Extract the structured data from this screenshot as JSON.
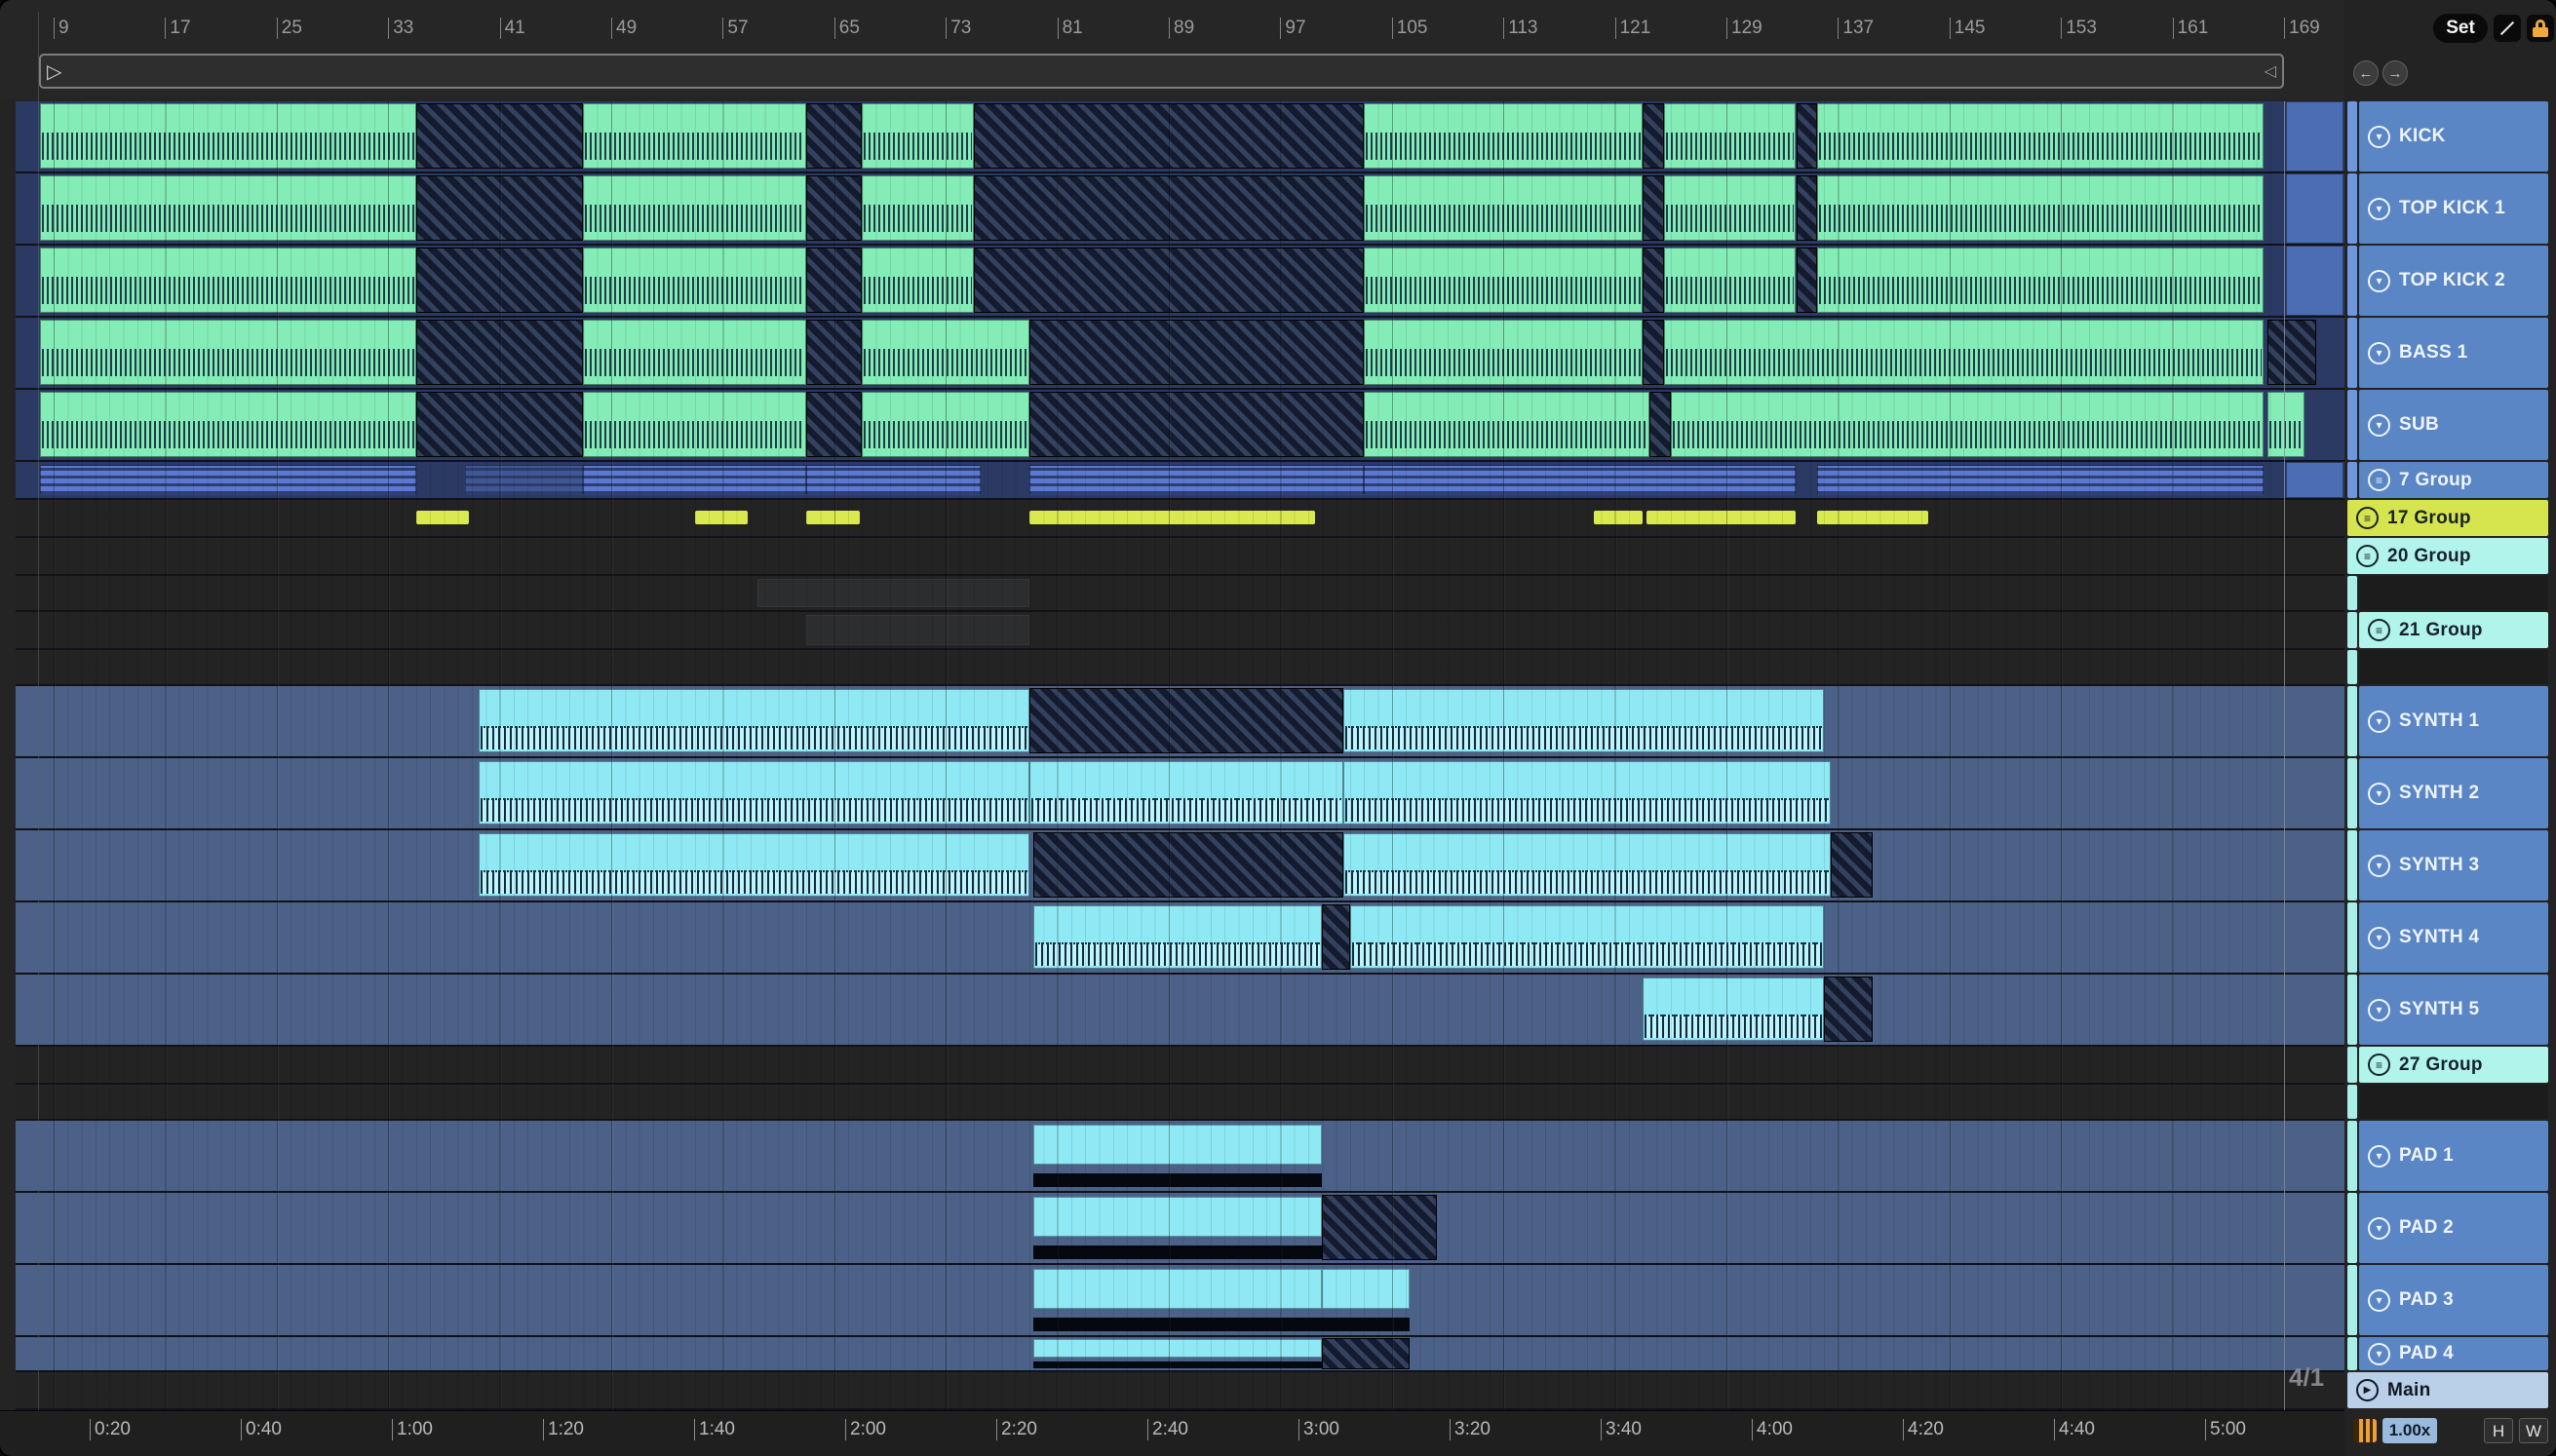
{
  "controls": {
    "set_label": "Set",
    "speed": "1.00x",
    "h_label": "H",
    "w_label": "W",
    "back_arrow": "←",
    "forward_arrow": "→",
    "icons": [
      "draw-mode-icon",
      "lock-icon",
      "audio-engine-icon"
    ]
  },
  "markers": {
    "time_signature": "4/1",
    "scroll_play_glyph": "▷",
    "scroll_end_glyph": "◁"
  },
  "ruler_top": {
    "bar_numbers": [
      9,
      17,
      25,
      33,
      41,
      49,
      57,
      65,
      73,
      81,
      89,
      97,
      105,
      113,
      121,
      129,
      137,
      145,
      153,
      161,
      169
    ]
  },
  "ruler_bottom": {
    "time_labels": [
      "0:20",
      "0:40",
      "1:00",
      "1:20",
      "1:40",
      "2:00",
      "2:20",
      "2:40",
      "3:00",
      "3:20",
      "3:40",
      "4:00",
      "4:20",
      "4:40",
      "5:00"
    ]
  },
  "colors": {
    "clip_green": "#84ecb6",
    "clip_cyan": "#8fe9f5",
    "clip_yellow": "#d9e94f",
    "clip_blue": "#5b79d2",
    "header_blue": "#5b86c5",
    "header_yellow": "#d6e54d",
    "header_cyan": "#b0f4ec",
    "header_main": "#bacfe8",
    "lock_orange": "#eda83f"
  },
  "tracks": [
    {
      "name": "KICK",
      "icon": "collapse",
      "header": "blue",
      "strip": "blue",
      "size": "tall",
      "zone": "navy",
      "clips": [
        {
          "s": 8,
          "e": 35,
          "k": "green"
        },
        {
          "s": 35,
          "e": 47,
          "k": "hatch"
        },
        {
          "s": 47,
          "e": 63,
          "k": "green"
        },
        {
          "s": 63,
          "e": 67,
          "k": "hatch"
        },
        {
          "s": 67,
          "e": 75,
          "k": "green"
        },
        {
          "s": 75,
          "e": 103,
          "k": "hatch"
        },
        {
          "s": 103,
          "e": 123,
          "k": "green"
        },
        {
          "s": 123,
          "e": 124.5,
          "k": "hatch"
        },
        {
          "s": 124.5,
          "e": 134,
          "k": "green"
        },
        {
          "s": 134,
          "e": 135.5,
          "k": "hatch"
        },
        {
          "s": 135.5,
          "e": 167.5,
          "k": "green"
        },
        {
          "s": 169.2,
          "e": 173.2,
          "k": "endblue"
        }
      ]
    },
    {
      "name": "TOP KICK 1",
      "icon": "collapse",
      "header": "blue",
      "strip": "blue",
      "size": "tall",
      "zone": "navy",
      "clips": [
        {
          "s": 8,
          "e": 35,
          "k": "green"
        },
        {
          "s": 35,
          "e": 47,
          "k": "hatch"
        },
        {
          "s": 47,
          "e": 63,
          "k": "green"
        },
        {
          "s": 63,
          "e": 67,
          "k": "hatch"
        },
        {
          "s": 67,
          "e": 75,
          "k": "green"
        },
        {
          "s": 75,
          "e": 103,
          "k": "hatch"
        },
        {
          "s": 103,
          "e": 123,
          "k": "green"
        },
        {
          "s": 123,
          "e": 124.5,
          "k": "hatch"
        },
        {
          "s": 124.5,
          "e": 134,
          "k": "green"
        },
        {
          "s": 134,
          "e": 135.5,
          "k": "hatch"
        },
        {
          "s": 135.5,
          "e": 167.5,
          "k": "green"
        },
        {
          "s": 169.2,
          "e": 173.2,
          "k": "endblue"
        }
      ]
    },
    {
      "name": "TOP KICK 2",
      "icon": "collapse",
      "header": "blue",
      "strip": "blue",
      "size": "tall",
      "zone": "navy",
      "clips": [
        {
          "s": 8,
          "e": 35,
          "k": "green"
        },
        {
          "s": 35,
          "e": 47,
          "k": "hatch"
        },
        {
          "s": 47,
          "e": 63,
          "k": "green"
        },
        {
          "s": 63,
          "e": 67,
          "k": "hatch"
        },
        {
          "s": 67,
          "e": 75,
          "k": "green"
        },
        {
          "s": 75,
          "e": 103,
          "k": "hatch"
        },
        {
          "s": 103,
          "e": 123,
          "k": "green"
        },
        {
          "s": 123,
          "e": 124.5,
          "k": "hatch"
        },
        {
          "s": 124.5,
          "e": 134,
          "k": "green"
        },
        {
          "s": 134,
          "e": 135.5,
          "k": "hatch"
        },
        {
          "s": 135.5,
          "e": 167.5,
          "k": "green"
        },
        {
          "s": 169.2,
          "e": 173.2,
          "k": "endblue"
        }
      ]
    },
    {
      "name": "BASS 1",
      "icon": "collapse",
      "header": "blue",
      "strip": "blue",
      "size": "tall",
      "zone": "navy",
      "clips": [
        {
          "s": 8,
          "e": 35,
          "k": "green"
        },
        {
          "s": 35,
          "e": 47,
          "k": "hatch"
        },
        {
          "s": 47,
          "e": 63,
          "k": "green"
        },
        {
          "s": 63,
          "e": 67,
          "k": "hatch"
        },
        {
          "s": 67,
          "e": 79,
          "k": "green"
        },
        {
          "s": 79,
          "e": 103,
          "k": "hatch"
        },
        {
          "s": 103,
          "e": 123,
          "k": "green"
        },
        {
          "s": 123,
          "e": 124.5,
          "k": "hatch"
        },
        {
          "s": 124.5,
          "e": 167.5,
          "k": "green"
        },
        {
          "s": 167.8,
          "e": 171.3,
          "k": "hatch"
        }
      ]
    },
    {
      "name": "SUB",
      "icon": "collapse",
      "header": "blue",
      "strip": "blue",
      "size": "tall",
      "zone": "navy",
      "clips": [
        {
          "s": 8,
          "e": 35,
          "k": "green"
        },
        {
          "s": 35,
          "e": 47,
          "k": "hatch"
        },
        {
          "s": 47,
          "e": 63,
          "k": "green"
        },
        {
          "s": 63,
          "e": 67,
          "k": "hatch"
        },
        {
          "s": 67,
          "e": 79,
          "k": "green"
        },
        {
          "s": 79,
          "e": 103,
          "k": "hatch"
        },
        {
          "s": 103,
          "e": 123.5,
          "k": "green"
        },
        {
          "s": 123.5,
          "e": 125,
          "k": "hatch"
        },
        {
          "s": 125,
          "e": 167.5,
          "k": "green"
        },
        {
          "s": 167.8,
          "e": 170.5,
          "k": "green"
        }
      ]
    },
    {
      "name": "7 Group",
      "icon": "group",
      "header": "blue",
      "strip": "blue",
      "size": "short",
      "zone": "navy",
      "clips": [
        {
          "s": 8,
          "e": 35,
          "k": "blue"
        },
        {
          "s": 38.5,
          "e": 47,
          "k": "bluefaint"
        },
        {
          "s": 47,
          "e": 63,
          "k": "blue"
        },
        {
          "s": 63,
          "e": 75.5,
          "k": "blue"
        },
        {
          "s": 79,
          "e": 103,
          "k": "blue"
        },
        {
          "s": 103,
          "e": 134,
          "k": "blue"
        },
        {
          "s": 135.5,
          "e": 167.5,
          "k": "blue"
        },
        {
          "s": 169.2,
          "e": 173.2,
          "k": "endblue"
        }
      ]
    },
    {
      "name": "17 Group",
      "icon": "group",
      "header": "yellow",
      "size": "short",
      "zone": "dark",
      "clips": [
        {
          "s": 35,
          "e": 38.8,
          "k": "yellow"
        },
        {
          "s": 55,
          "e": 58.8,
          "k": "yellow"
        },
        {
          "s": 63,
          "e": 66.8,
          "k": "yellow"
        },
        {
          "s": 79,
          "e": 99.5,
          "k": "yellow"
        },
        {
          "s": 119.5,
          "e": 123,
          "k": "yellow"
        },
        {
          "s": 123.3,
          "e": 134,
          "k": "yellow"
        },
        {
          "s": 135.5,
          "e": 143.5,
          "k": "yellow"
        }
      ]
    },
    {
      "name": "20 Group",
      "icon": "group",
      "header": "cyan",
      "size": "short",
      "zone": "dark",
      "clips": []
    },
    {
      "type": "spacer",
      "strip": "cyan",
      "zone": "dark",
      "clips": [
        {
          "s": 59.5,
          "e": 79,
          "k": "ghost"
        }
      ]
    },
    {
      "name": "21 Group",
      "icon": "group",
      "header": "cyan",
      "strip": "cyan",
      "size": "short",
      "zone": "dark",
      "clips": [
        {
          "s": 63,
          "e": 79,
          "k": "ghost"
        }
      ]
    },
    {
      "type": "spacer",
      "strip": "cyan",
      "zone": "dark",
      "clips": []
    },
    {
      "name": "SYNTH 1",
      "icon": "collapse",
      "header": "blue",
      "strip": "cyan",
      "size": "tall",
      "zone": "steel",
      "clips": [
        {
          "s": 39.5,
          "e": 79,
          "k": "cyan"
        },
        {
          "s": 79,
          "e": 101.5,
          "k": "hatch"
        },
        {
          "s": 101.5,
          "e": 136,
          "k": "cyan"
        }
      ]
    },
    {
      "name": "SYNTH 2",
      "icon": "collapse",
      "header": "blue",
      "strip": "cyan",
      "size": "tall",
      "zone": "steel",
      "clips": [
        {
          "s": 39.5,
          "e": 79,
          "k": "cyan"
        },
        {
          "s": 79,
          "e": 101.5,
          "k": "cyan"
        },
        {
          "s": 101.5,
          "e": 136.5,
          "k": "cyan"
        }
      ]
    },
    {
      "name": "SYNTH 3",
      "icon": "collapse",
      "header": "blue",
      "strip": "cyan",
      "size": "tall",
      "zone": "steel",
      "clips": [
        {
          "s": 39.5,
          "e": 79,
          "k": "cyan"
        },
        {
          "s": 79.3,
          "e": 101.5,
          "k": "hatch"
        },
        {
          "s": 101.5,
          "e": 136.5,
          "k": "cyan"
        },
        {
          "s": 136.5,
          "e": 139.5,
          "k": "hatch"
        }
      ]
    },
    {
      "name": "SYNTH 4",
      "icon": "collapse",
      "header": "blue",
      "strip": "cyan",
      "size": "tall",
      "zone": "steel",
      "clips": [
        {
          "s": 79.3,
          "e": 100,
          "k": "cyan"
        },
        {
          "s": 100,
          "e": 102,
          "k": "hatch"
        },
        {
          "s": 102,
          "e": 136,
          "k": "cyan"
        }
      ]
    },
    {
      "name": "SYNTH 5",
      "icon": "collapse",
      "header": "blue",
      "strip": "cyan",
      "size": "tall",
      "zone": "steel",
      "clips": [
        {
          "s": 123,
          "e": 136,
          "k": "cyan"
        },
        {
          "s": 136,
          "e": 139.5,
          "k": "hatch"
        }
      ]
    },
    {
      "name": "27 Group",
      "icon": "group",
      "header": "cyan",
      "strip": "cyan",
      "size": "short",
      "zone": "dark",
      "clips": []
    },
    {
      "type": "spacer",
      "strip": "cyan",
      "zone": "dark",
      "clips": []
    },
    {
      "name": "PAD 1",
      "icon": "collapse",
      "header": "blue",
      "strip": "cyan",
      "size": "tall",
      "zone": "steel",
      "clips": [
        {
          "s": 79.3,
          "e": 100,
          "k": "cyanpad"
        }
      ]
    },
    {
      "name": "PAD 2",
      "icon": "collapse",
      "header": "blue",
      "strip": "cyan",
      "size": "tall",
      "zone": "steel",
      "clips": [
        {
          "s": 79.3,
          "e": 100,
          "k": "cyanpad"
        },
        {
          "s": 100,
          "e": 108.2,
          "k": "hatch"
        }
      ]
    },
    {
      "name": "PAD 3",
      "icon": "collapse",
      "header": "blue",
      "strip": "cyan",
      "size": "tall",
      "zone": "steel",
      "clips": [
        {
          "s": 79.3,
          "e": 100,
          "k": "cyanpad"
        },
        {
          "s": 100,
          "e": 106.3,
          "k": "cyanpad"
        }
      ]
    },
    {
      "name": "PAD 4",
      "icon": "collapse",
      "header": "blue",
      "strip": "cyan",
      "size": "cut",
      "zone": "steel",
      "clips": [
        {
          "s": 79.3,
          "e": 100,
          "k": "cyanpad"
        },
        {
          "s": 100,
          "e": 106.3,
          "k": "hatch"
        }
      ]
    },
    {
      "name": "Main",
      "icon": "play",
      "header": "main",
      "size": "short",
      "zone": "dark",
      "clips": []
    }
  ]
}
